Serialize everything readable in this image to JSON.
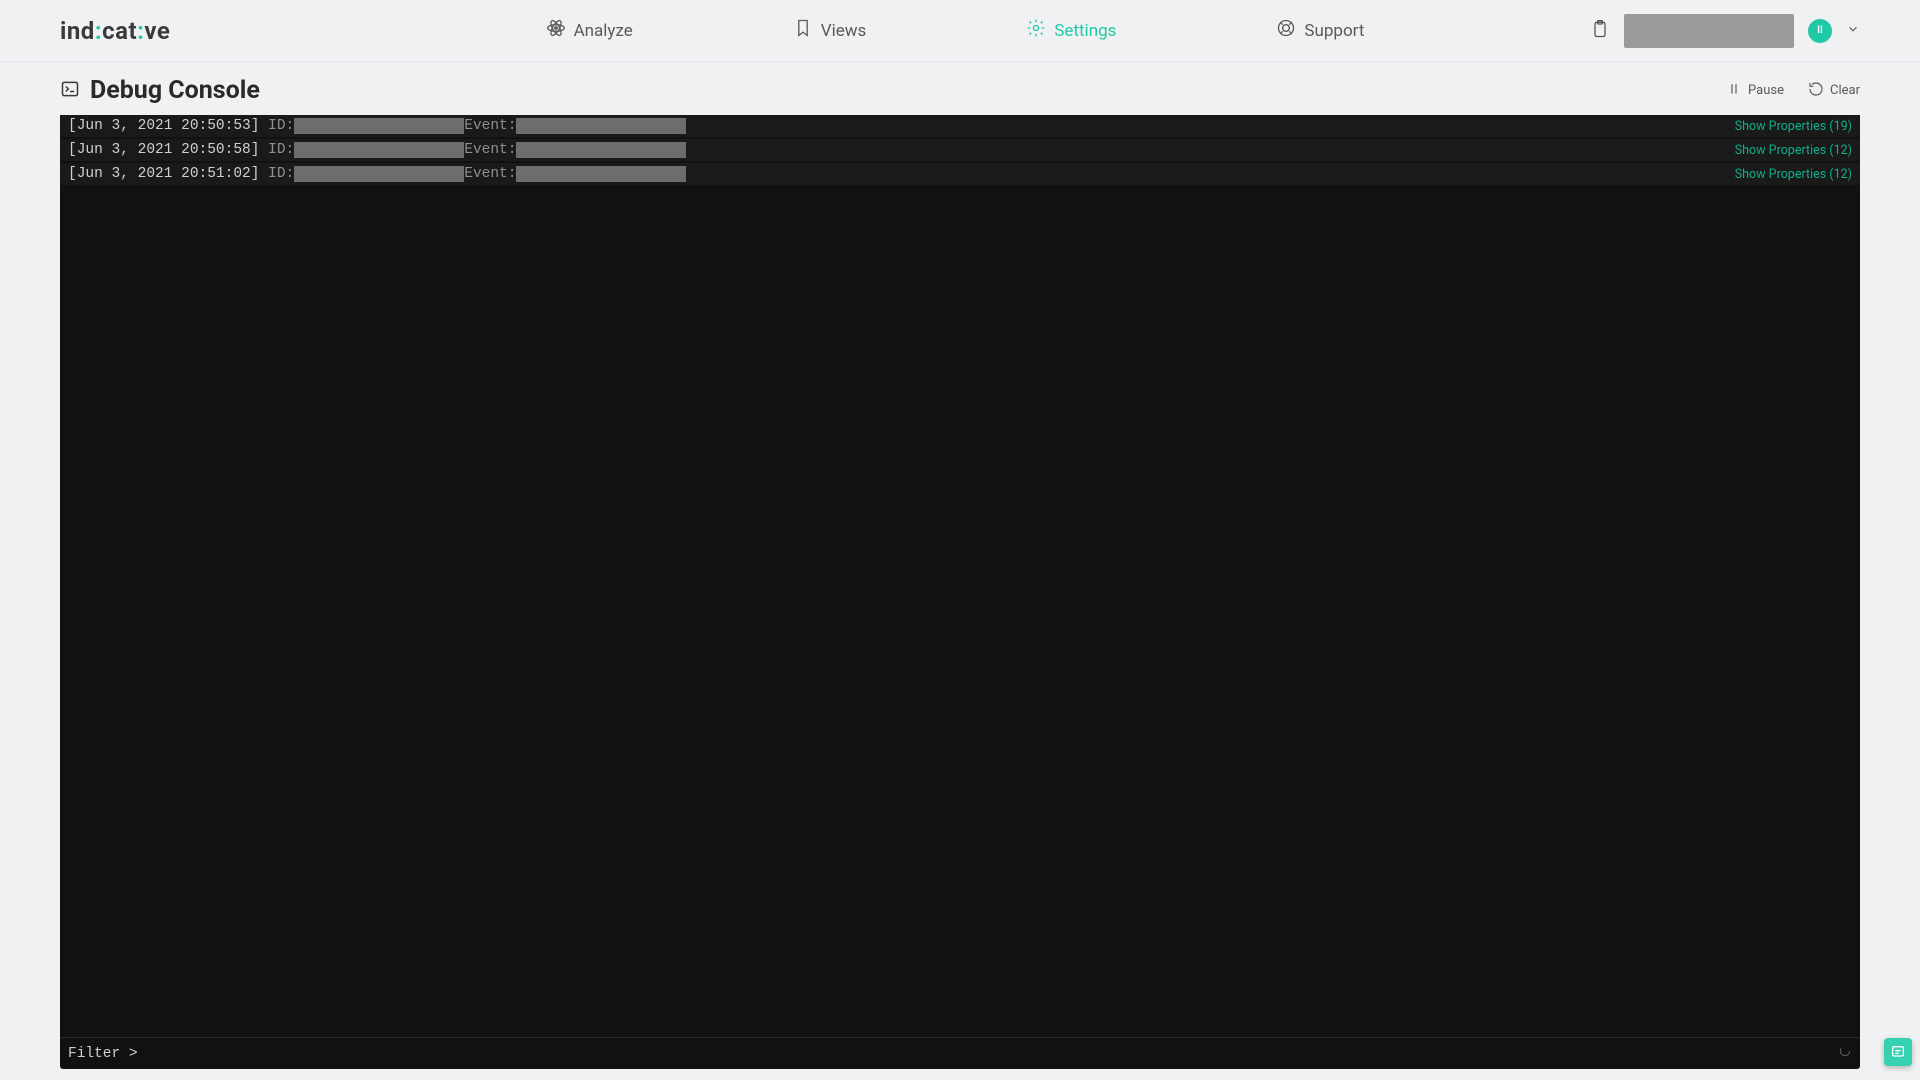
{
  "brand": {
    "name": "indicative",
    "accent": "#20c9a6"
  },
  "nav": {
    "analyze": "Analyze",
    "views": "Views",
    "settings": "Settings",
    "support": "Support",
    "active": "settings"
  },
  "user": {
    "initials": "II"
  },
  "page": {
    "title": "Debug Console",
    "pause": "Pause",
    "clear": "Clear"
  },
  "console": {
    "filter_prompt": "Filter > ",
    "id_label": " ID:",
    "event_label": "Event:",
    "show_props_label": "Show Properties",
    "rows": [
      {
        "ts": "[Jun 3, 2021 20:50:53]",
        "props_count": 19
      },
      {
        "ts": "[Jun 3, 2021 20:50:58]",
        "props_count": 12
      },
      {
        "ts": "[Jun 3, 2021 20:51:02]",
        "props_count": 12
      }
    ]
  }
}
